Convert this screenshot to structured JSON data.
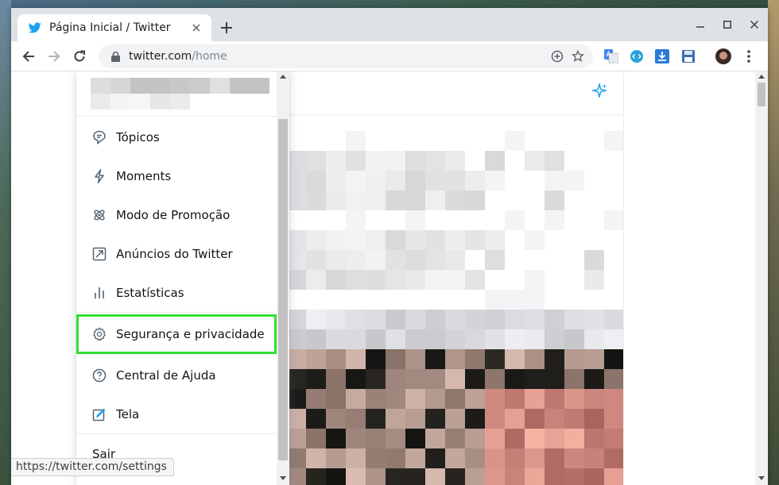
{
  "browser": {
    "tab_title": "Página Inicial / Twitter",
    "url_host": "twitter.com",
    "url_path": "/home",
    "status_url": "https://twitter.com/settings"
  },
  "menu": {
    "items": [
      {
        "label": "Tópicos",
        "icon": "topics-icon"
      },
      {
        "label": "Moments",
        "icon": "moments-icon"
      },
      {
        "label": "Modo de Promoção",
        "icon": "promote-mode-icon"
      },
      {
        "label": "Anúncios do Twitter",
        "icon": "twitter-ads-icon"
      },
      {
        "label": "Estatísticas",
        "icon": "analytics-icon"
      }
    ],
    "settings_label": "Segurança e privacidade",
    "help_label": "Central de Ajuda",
    "display_label": "Tela",
    "logout_label": "Sair"
  },
  "colors": {
    "twitter_blue": "#1da1f2",
    "highlight": "#33e033"
  }
}
